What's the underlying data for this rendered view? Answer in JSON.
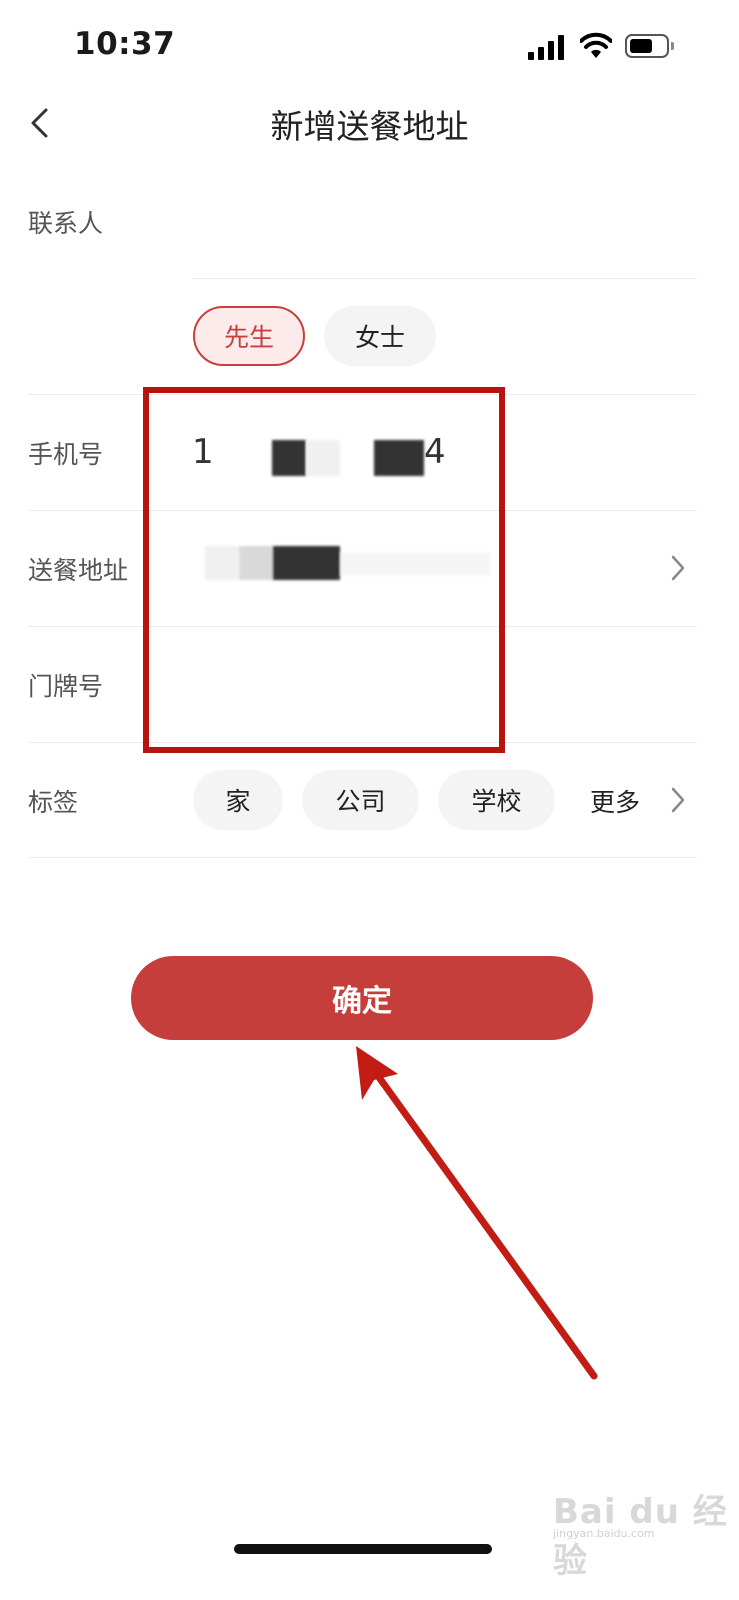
{
  "status_bar": {
    "time": "10:37"
  },
  "nav": {
    "title": "新增送餐地址"
  },
  "form": {
    "contact_label": "联系人",
    "gender_options": [
      "先生",
      "女士"
    ],
    "phone_label": "手机号",
    "phone_prefix": "1",
    "phone_suffix": "4",
    "address_label": "送餐地址",
    "door_label": "门牌号",
    "tag_label": "标签",
    "tag_options": [
      "家",
      "公司",
      "学校"
    ],
    "tag_more": "更多"
  },
  "confirm_label": "确定",
  "watermark": {
    "text": "Bai du 经验",
    "sub": "jingyan.baidu.com"
  }
}
